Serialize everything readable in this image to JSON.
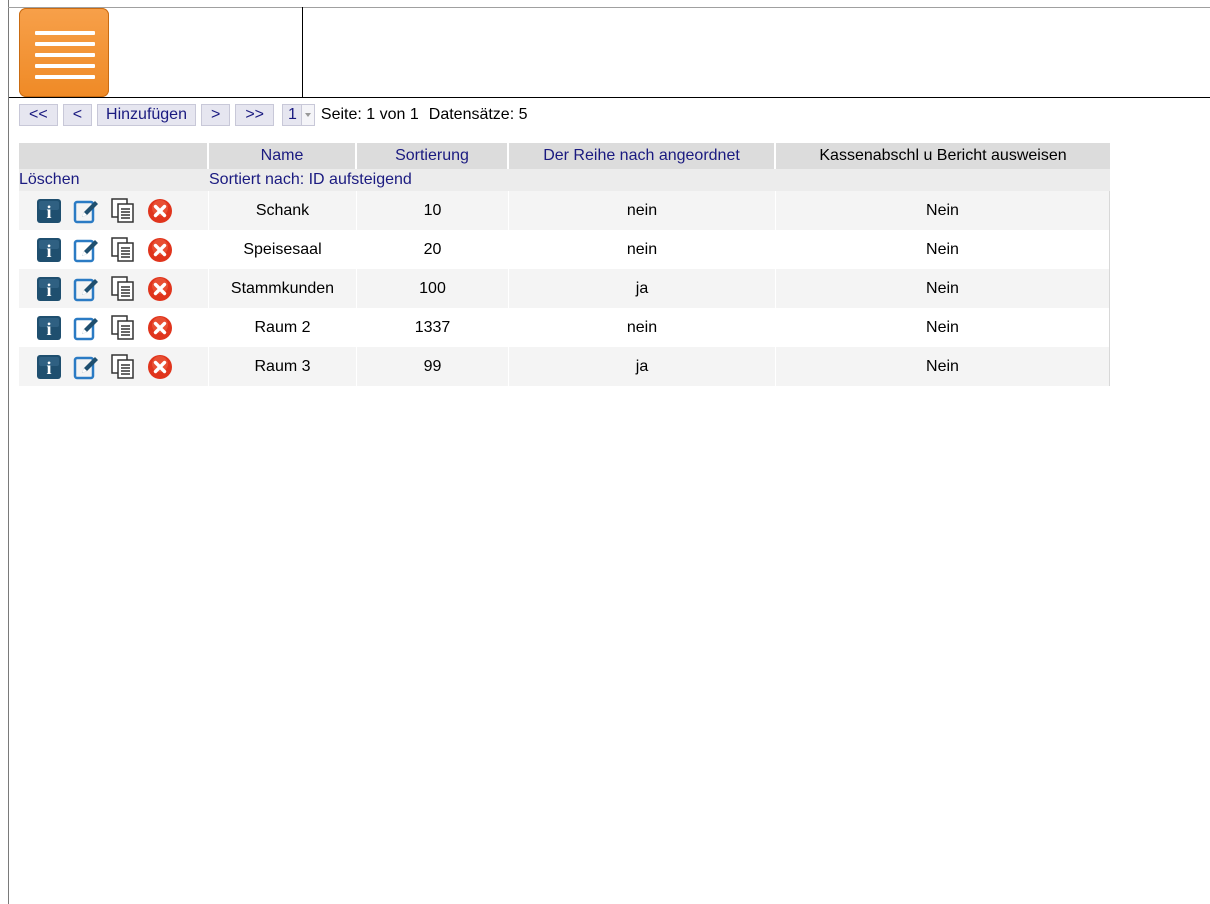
{
  "toolbar": {
    "first_label": "<<",
    "prev_label": "<",
    "add_label": "Hinzufügen",
    "next_label": ">",
    "last_label": ">>",
    "page_value": "1",
    "page_info": "Seite: 1 von 1",
    "records_info": "Datensätze: 5"
  },
  "table": {
    "columns": [
      "Name",
      "Sortierung",
      "Der Reihe nach angeordnet",
      "Kassenabschl u Bericht ausweisen"
    ],
    "delete_label": "Löschen",
    "sort_info": "Sortiert nach: ID aufsteigend",
    "rows": [
      {
        "name": "Schank",
        "sort": "10",
        "reihe": "nein",
        "kasse": "Nein"
      },
      {
        "name": "Speisesaal",
        "sort": "20",
        "reihe": "nein",
        "kasse": "Nein"
      },
      {
        "name": "Stammkunden",
        "sort": "100",
        "reihe": "ja",
        "kasse": "Nein"
      },
      {
        "name": "Raum 2",
        "sort": "1337",
        "reihe": "nein",
        "kasse": "Nein"
      },
      {
        "name": "Raum 3",
        "sort": "99",
        "reihe": "ja",
        "kasse": "Nein"
      }
    ]
  },
  "colors": {
    "menu_orange": "#f08c2a",
    "link_blue": "#1a1a80",
    "info_icon": "#1f4f6f",
    "delete_icon": "#e0341c"
  },
  "icons": [
    "hamburger-menu-icon",
    "info-icon",
    "edit-icon",
    "copy-icon",
    "delete-icon"
  ]
}
